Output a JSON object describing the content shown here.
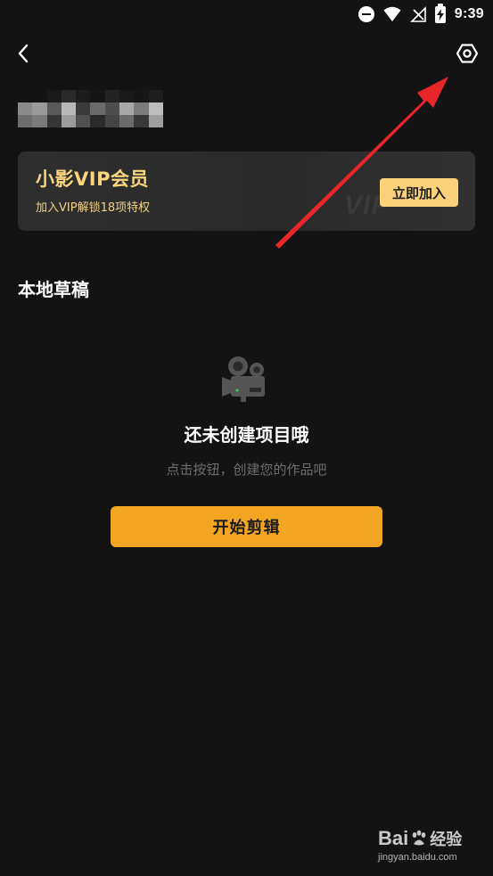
{
  "status_bar": {
    "time": "9:39",
    "icons": [
      "do-not-disturb-icon",
      "wifi-icon",
      "no-signal-icon",
      "battery-charging-icon"
    ]
  },
  "header": {
    "back_icon": "chevron-left-icon",
    "settings_icon": "hexagon-settings-icon"
  },
  "profile": {
    "username_obscured": true
  },
  "vip_card": {
    "title": "小影VIP会员",
    "subtitle": "加入VIP解锁18项特权",
    "watermark": "VIP",
    "join_label": "立即加入"
  },
  "drafts": {
    "section_title": "本地草稿",
    "empty_icon": "video-camera-icon",
    "empty_title": "还未创建项目哦",
    "empty_subtitle": "点击按钮，创建您的作品吧",
    "start_label": "开始剪辑"
  },
  "annotation": {
    "arrow_color": "#e8262a"
  },
  "watermark": {
    "logo_text": "Bai",
    "logo_suffix": "经验",
    "url": "jingyan.baidu.com"
  },
  "colors": {
    "background": "#131313",
    "vip_gold": "#f8d57e",
    "join_button": "#fbd27a",
    "primary_button": "#f2a523"
  }
}
